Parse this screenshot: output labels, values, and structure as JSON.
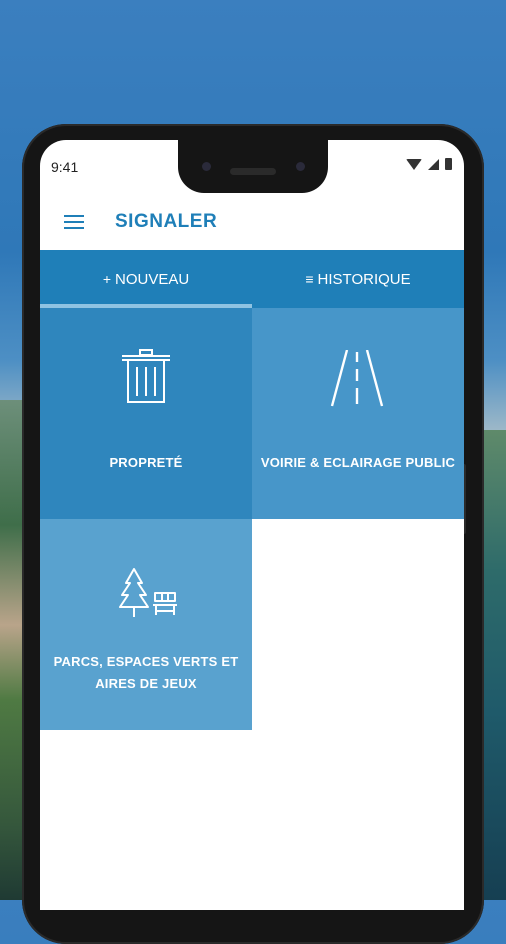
{
  "status_bar": {
    "time": "9:41"
  },
  "app_bar": {
    "title": "SIGNALER"
  },
  "tabs": [
    {
      "label": "NOUVEAU",
      "icon": "+",
      "selected": true
    },
    {
      "label": "HISTORIQUE",
      "icon": "≡",
      "selected": false
    }
  ],
  "categories": [
    {
      "label": "PROPRETÉ",
      "icon": "trash-icon"
    },
    {
      "label": "VOIRIE & ECLAIRAGE PUBLIC",
      "icon": "road-icon"
    },
    {
      "label_line1": "PARCS, ESPACES VERTS ET",
      "label_line2": "AIRES DE JEUX",
      "icon": "park-bench-icon"
    }
  ],
  "colors": {
    "primary": "#1f7fb8",
    "tile_1": "#2f86bd",
    "tile_2": "#4796c9",
    "tile_3": "#59a2cf"
  }
}
